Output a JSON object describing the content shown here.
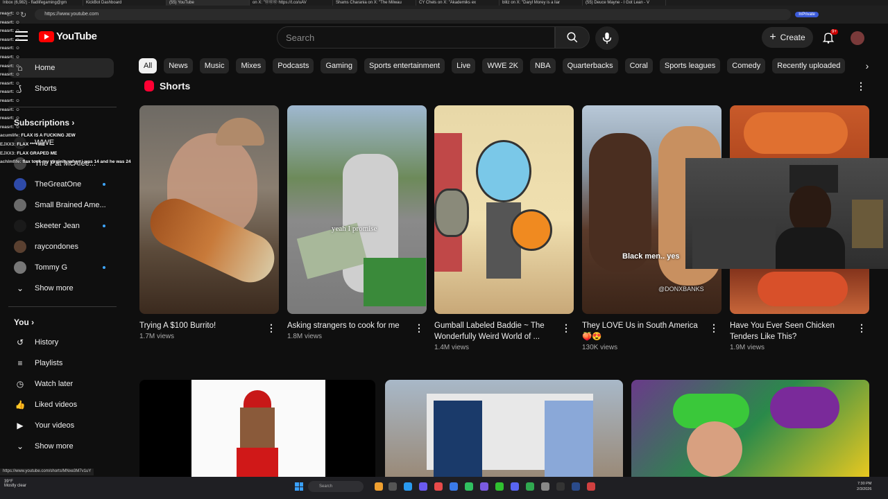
{
  "browser": {
    "tabs": [
      "Inbox (6,982) - fladlifegaming@gm",
      "KickBot Dashboard",
      "(55) YouTube",
      "on X: \"ⓄⓄⓄ https://t.co/uAV",
      "Shams Charania on X: \"The Milwau",
      "CY Chels on X: \"Akademiks ex",
      "blitz on X: \"Daryl Morey is a liar",
      "(55) Deuce Mayne - I Got Lean - V"
    ],
    "active_tab": 2,
    "url": "https://www.youtube.com",
    "inprivate_label": "InPrivate"
  },
  "header": {
    "logo_text": "YouTube",
    "search_placeholder": "Search",
    "create_label": "Create",
    "notification_count": "9+"
  },
  "chips": [
    "All",
    "News",
    "Music",
    "Mixes",
    "Podcasts",
    "Gaming",
    "Sports entertainment",
    "Live",
    "WWE 2K",
    "NBA",
    "Quarterbacks",
    "Coral",
    "Sports leagues",
    "Comedy",
    "Recently uploaded"
  ],
  "sidebar": {
    "main": [
      {
        "label": "Home",
        "icon": "home-icon"
      },
      {
        "label": "Shorts",
        "icon": "shorts-icon"
      }
    ],
    "subscriptions_heading": "Subscriptions",
    "subscriptions": [
      {
        "label": "WWE",
        "live": false,
        "color": "#222222"
      },
      {
        "label": "The Pat McAfee...",
        "live": false,
        "color": "#444444"
      },
      {
        "label": "TheGreatOne",
        "live": true,
        "color": "#2e4aa8"
      },
      {
        "label": "Small Brained Ame...",
        "live": false,
        "color": "#6b6b6b"
      },
      {
        "label": "Skeeter Jean",
        "live": true,
        "color": "#1a1a1a"
      },
      {
        "label": "raycondones",
        "live": false,
        "color": "#5a4030"
      },
      {
        "label": "Tommy G",
        "live": true,
        "color": "#777777"
      }
    ],
    "show_more_1": "Show more",
    "you_heading": "You",
    "you_items": [
      {
        "label": "History",
        "icon": "history-icon"
      },
      {
        "label": "Playlists",
        "icon": "playlists-icon"
      },
      {
        "label": "Watch later",
        "icon": "watch-later-icon"
      },
      {
        "label": "Liked videos",
        "icon": "liked-videos-icon"
      },
      {
        "label": "Your videos",
        "icon": "your-videos-icon"
      }
    ],
    "show_more_2": "Show more"
  },
  "chat": [
    {
      "name": "reasrt:",
      "msg": "☺"
    },
    {
      "name": "reasrt:",
      "msg": "☺"
    },
    {
      "name": "reasrt:",
      "msg": "☺"
    },
    {
      "name": "reasrt:",
      "msg": "☺"
    },
    {
      "name": "reasrt:",
      "msg": "☺"
    },
    {
      "name": "reasrt:",
      "msg": "☺"
    },
    {
      "name": "reasrt:",
      "msg": "☺"
    },
    {
      "name": "reasrt:",
      "msg": "☺"
    },
    {
      "name": "reasrt:",
      "msg": "☺"
    },
    {
      "name": "reasrt:",
      "msg": "☺"
    },
    {
      "name": "reasrt:",
      "msg": "☺"
    },
    {
      "name": "reasrt:",
      "msg": "☺"
    },
    {
      "name": "reasrt:",
      "msg": "☺"
    },
    {
      "name": "reasrt:",
      "msg": "☺"
    },
    {
      "name": "acumlife:",
      "msg": "FLAX IS A FUCKING JEW"
    },
    {
      "name": "EJXX3:",
      "msg": "FLAX **** ME"
    },
    {
      "name": "EJXX3:",
      "msg": "FLAX GRAPED ME"
    },
    {
      "name": "achlmfife:",
      "msg": "flax took my virginity when i was 14 and he was 24"
    }
  ],
  "shorts": {
    "title": "Shorts",
    "items": [
      {
        "title": "Trying A $100 Burrito!",
        "views": "1.7M views"
      },
      {
        "title": "Asking strangers to cook for me",
        "views": "1.8M views",
        "caption": "yeah I promise"
      },
      {
        "title": "Gumball Labeled Baddie ~ The Wonderfully Weird World of ...",
        "views": "1.4M views"
      },
      {
        "title": "They LOVE Us in South America 🍑😍",
        "views": "130K views",
        "caption": "Black men.. yes",
        "watermark": "@DONXBANKS"
      },
      {
        "title": "Have You Ever Seen Chicken Tenders Like This?",
        "views": "1.9M views"
      }
    ]
  },
  "status_url": "https://www.youtube.com/shorts/MNxe3M7v1uY",
  "taskbar": {
    "weather_temp": "39°F",
    "weather_desc": "Mostly clear",
    "search_label": "Search",
    "time": "7:30 PM",
    "date": "2/3/2026"
  }
}
